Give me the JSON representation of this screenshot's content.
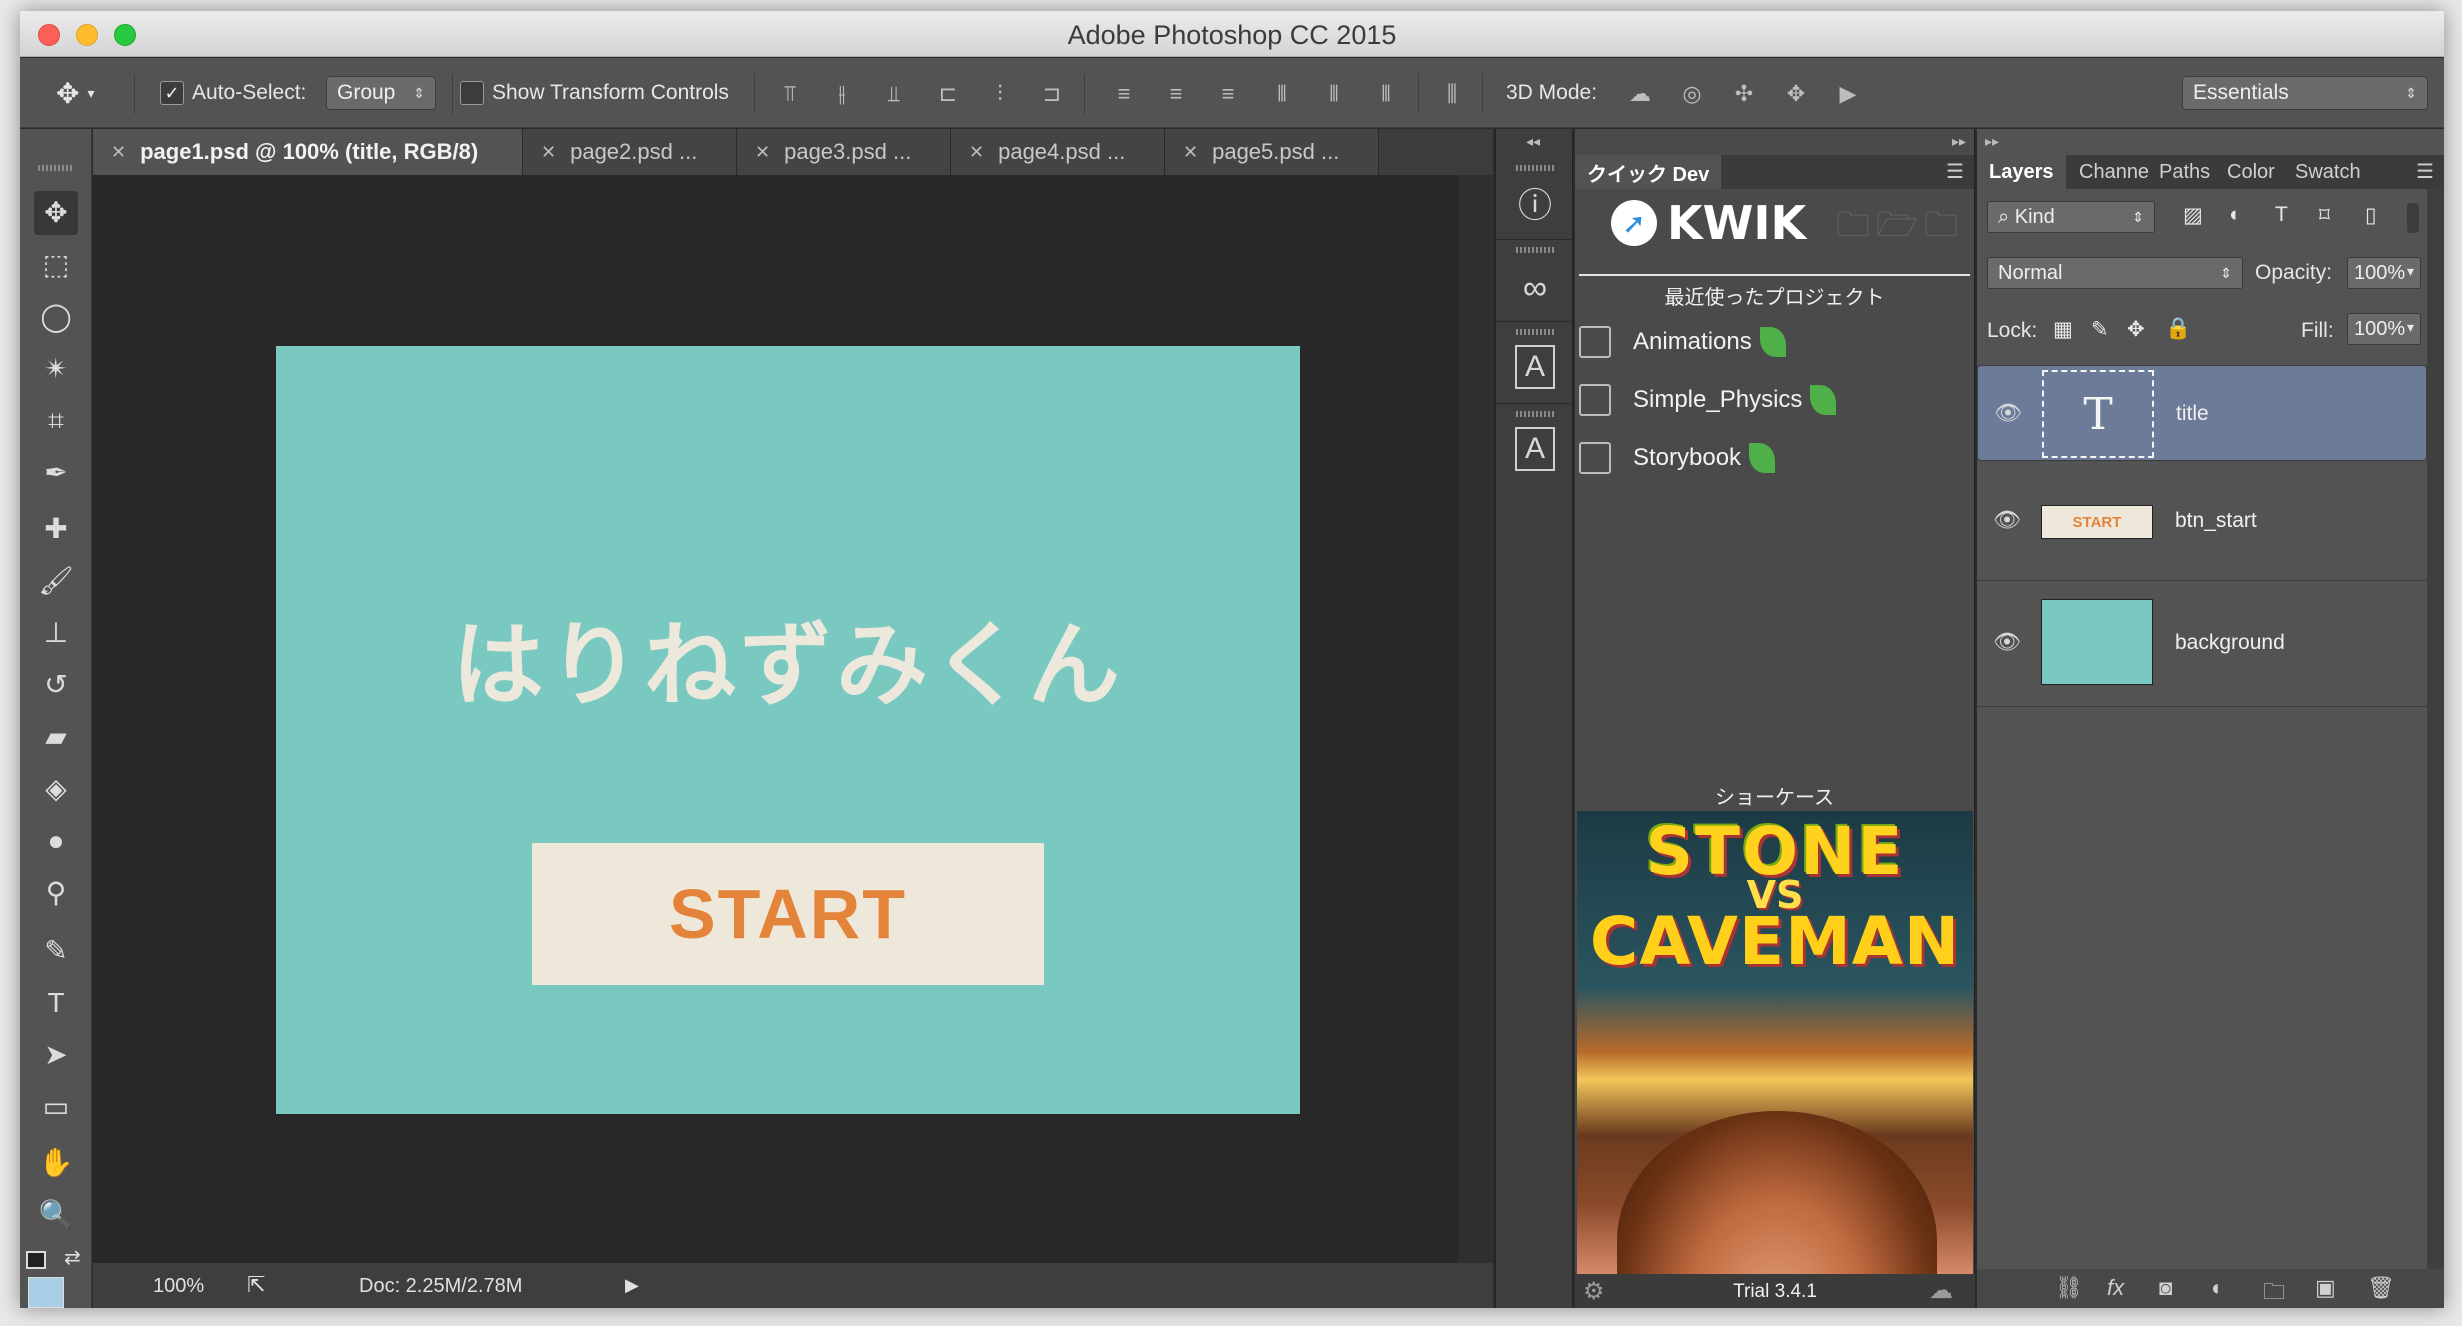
{
  "window": {
    "title": "Adobe Photoshop CC 2015"
  },
  "options_bar": {
    "auto_select_label": "Auto-Select:",
    "auto_select_value": "Group",
    "show_transform_label": "Show Transform Controls",
    "mode_3d_label": "3D Mode:",
    "workspace": "Essentials"
  },
  "tabs": [
    {
      "label": "page1.psd @ 100% (title, RGB/8)",
      "active": true
    },
    {
      "label": "page2.psd ...",
      "active": false
    },
    {
      "label": "page3.psd ...",
      "active": false
    },
    {
      "label": "page4.psd ...",
      "active": false
    },
    {
      "label": "page5.psd ...",
      "active": false
    }
  ],
  "canvas": {
    "heading": "はりねずみくん",
    "start_button": "START",
    "bg_color": "#7ac9c0",
    "accent_color": "#e4843a"
  },
  "status_bar": {
    "zoom": "100%",
    "doc_size": "Doc: 2.25M/2.78M"
  },
  "kwik_panel": {
    "tab_label": "クイック Dev",
    "logo_text": "KWIK",
    "recent_heading": "最近使ったプロジェクト",
    "projects": [
      "Animations",
      "Simple_Physics",
      "Storybook"
    ],
    "showcase_heading": "ショーケース",
    "showcase_title_line1": "STONE",
    "showcase_title_vs": "VS",
    "showcase_title_line2": "CAVEMAN",
    "version": "Trial 3.4.1"
  },
  "layers_panel": {
    "tabs": [
      "Layers",
      "Channe",
      "Paths",
      "Color",
      "Swatch"
    ],
    "filter_kind": "Kind",
    "blend_mode": "Normal",
    "opacity_label": "Opacity:",
    "opacity_value": "100%",
    "lock_label": "Lock:",
    "fill_label": "Fill:",
    "fill_value": "100%",
    "layers": [
      {
        "name": "title",
        "type": "text",
        "selected": true
      },
      {
        "name": "btn_start",
        "type": "image",
        "thumb_text": "START",
        "selected": false
      },
      {
        "name": "background",
        "type": "fill",
        "selected": false
      }
    ]
  }
}
